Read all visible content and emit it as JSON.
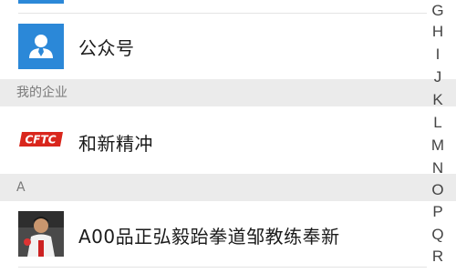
{
  "contacts": {
    "official_accounts_label": "公众号",
    "section_my_enterprise": "我的企业",
    "enterprise_name": "和新精冲",
    "enterprise_logo_text": "CFTC",
    "section_a": "A",
    "contact_a_name": "A00品正弘毅跆拳道邹教练奉新"
  },
  "index_bar": [
    "G",
    "H",
    "I",
    "J",
    "K",
    "L",
    "M",
    "N",
    "O",
    "P",
    "Q",
    "R"
  ],
  "colors": {
    "accent_blue": "#2b88d8",
    "logo_red": "#d9261c"
  }
}
